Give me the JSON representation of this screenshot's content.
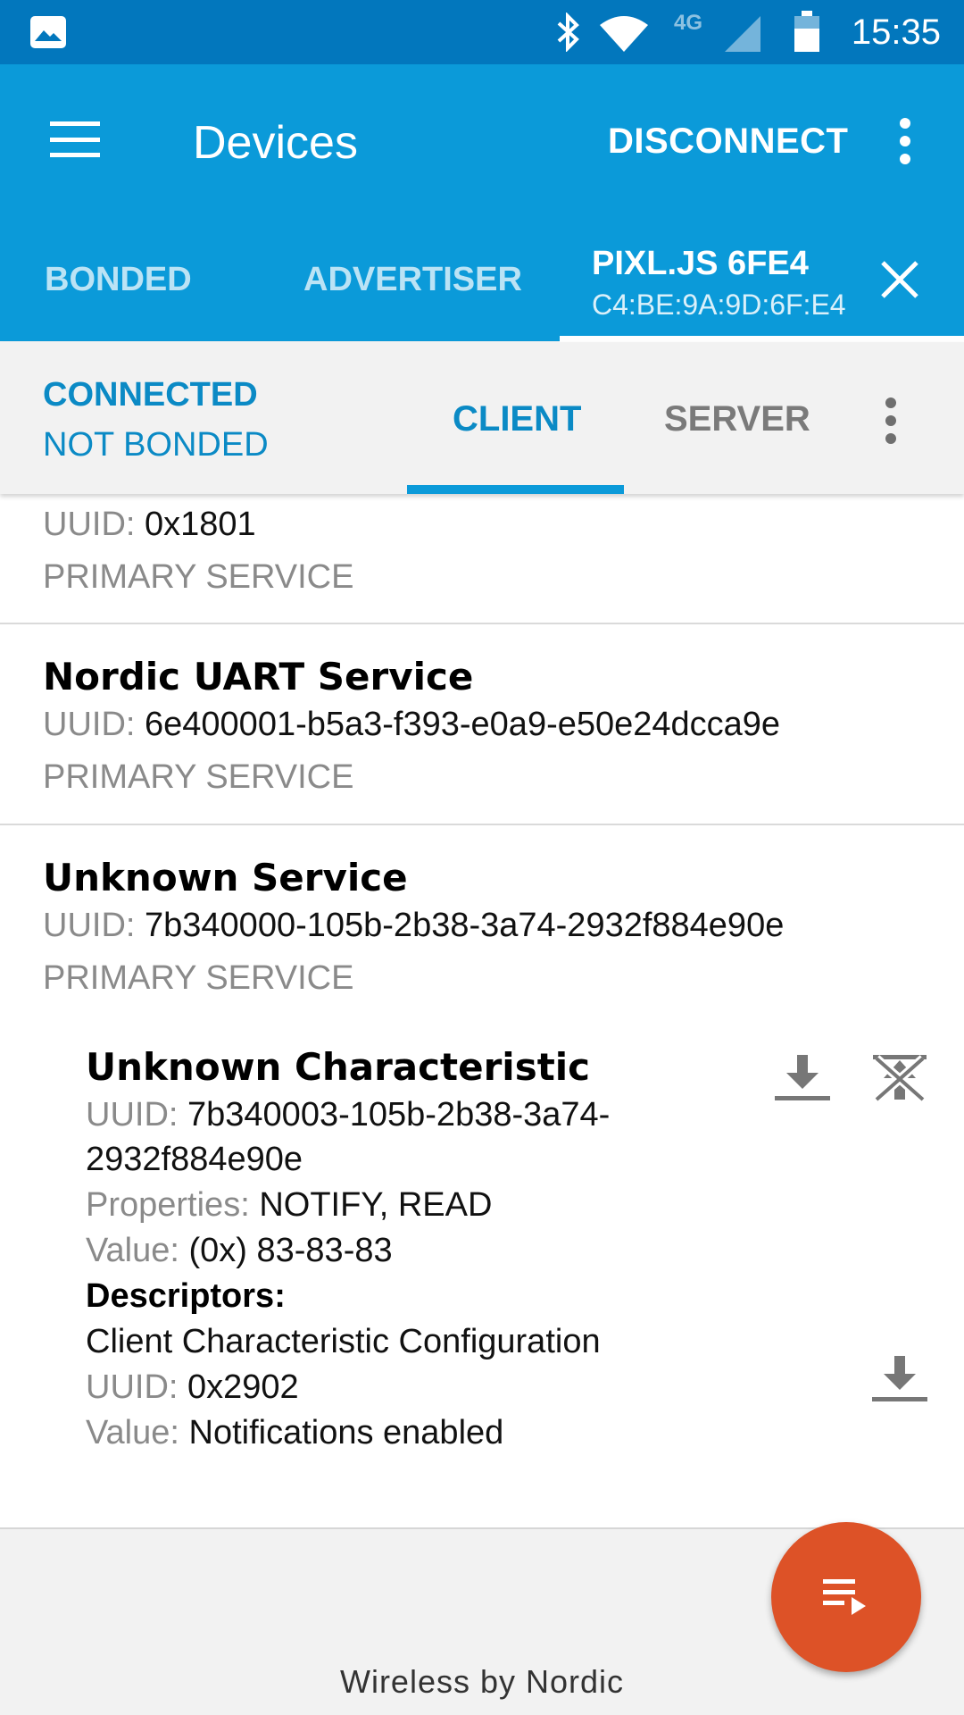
{
  "status_bar": {
    "time": "15:35",
    "network": "4G",
    "icons": [
      "gallery-icon",
      "bluetooth-icon",
      "wifi-icon",
      "signal-icon",
      "battery-icon"
    ]
  },
  "app_bar": {
    "title": "Devices",
    "disconnect_label": "DISCONNECT",
    "menu_icon": "hamburger-menu-icon",
    "overflow_icon": "more-vert-icon"
  },
  "tabs": {
    "bonded": "BONDED",
    "advertiser": "ADVERTISER",
    "device_name": "PIXL.JS 6FE4",
    "device_mac": "C4:BE:9A:9D:6F:E4"
  },
  "connection": {
    "state": "CONNECTED",
    "bond_state": "NOT BONDED",
    "client_tab": "CLIENT",
    "server_tab": "SERVER"
  },
  "services": [
    {
      "name": "",
      "uuid_label": "UUID:",
      "uuid": "0x1801",
      "type": "PRIMARY SERVICE"
    },
    {
      "name": "Nordic UART Service",
      "uuid_label": "UUID:",
      "uuid": "6e400001-b5a3-f393-e0a9-e50e24dcca9e",
      "type": "PRIMARY SERVICE"
    },
    {
      "name": "Unknown Service",
      "uuid_label": "UUID:",
      "uuid": "7b340000-105b-2b38-3a74-2932f884e90e",
      "type": "PRIMARY SERVICE"
    }
  ],
  "characteristic": {
    "name": "Unknown Characteristic",
    "uuid_label": "UUID:",
    "uuid_line1": "7b340003-105b-2b38-3a74-",
    "uuid_line2": "2932f884e90e",
    "properties_label": "Properties:",
    "properties": "NOTIFY, READ",
    "value_label": "Value:",
    "value": "(0x) 83-83-83",
    "descriptors_label": "Descriptors:",
    "descriptor": {
      "name": "Client Characteristic Configuration",
      "uuid_label": "UUID:",
      "uuid": "0x2902",
      "value_label": "Value:",
      "value": "Notifications enabled"
    }
  },
  "footer": {
    "brand": "Wireless by Nordic"
  },
  "colors": {
    "status_bar": "#0277bd",
    "app_bar": "#0b9ad9",
    "accent_text": "#0b8ac5",
    "fab": "#dd5227"
  }
}
